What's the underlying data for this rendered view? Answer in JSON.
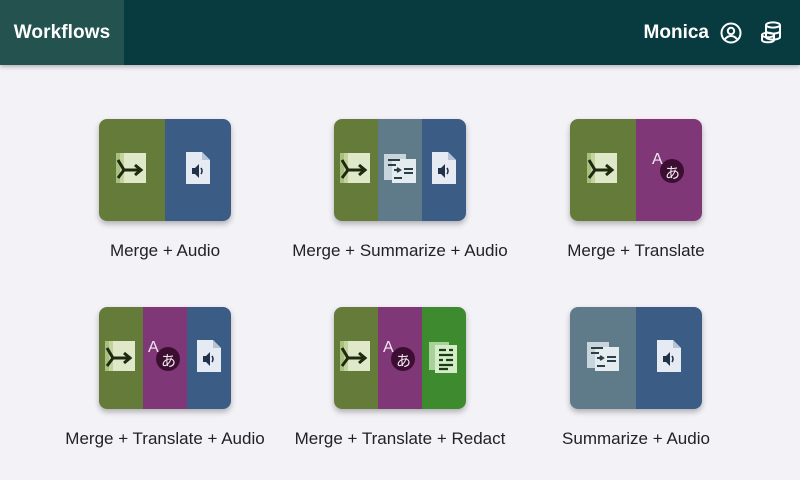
{
  "app": {
    "title": "Workflows"
  },
  "user": {
    "name": "Monica",
    "user_icon": "account-circle-icon",
    "db_icon": "database-icon"
  },
  "colors": {
    "header_bg": "#073b40",
    "brand_bg": "#23524f",
    "merge": "#657b3a",
    "audio": "#3a5c85",
    "summarize": "#5f7a88",
    "translate": "#7f3778",
    "redact": "#3e8a2e"
  },
  "workflows": [
    {
      "label": "Merge + Audio",
      "steps": [
        "merge",
        "audio"
      ]
    },
    {
      "label": "Merge + Summarize + Audio",
      "steps": [
        "merge",
        "summarize",
        "audio"
      ]
    },
    {
      "label": "Merge + Translate",
      "steps": [
        "merge",
        "translate"
      ]
    },
    {
      "label": "Merge + Translate + Audio",
      "steps": [
        "merge",
        "translate",
        "audio"
      ]
    },
    {
      "label": "Merge + Translate + Redact",
      "steps": [
        "merge",
        "translate",
        "redact"
      ]
    },
    {
      "label": "Summarize + Audio",
      "steps": [
        "summarize",
        "audio"
      ]
    }
  ]
}
